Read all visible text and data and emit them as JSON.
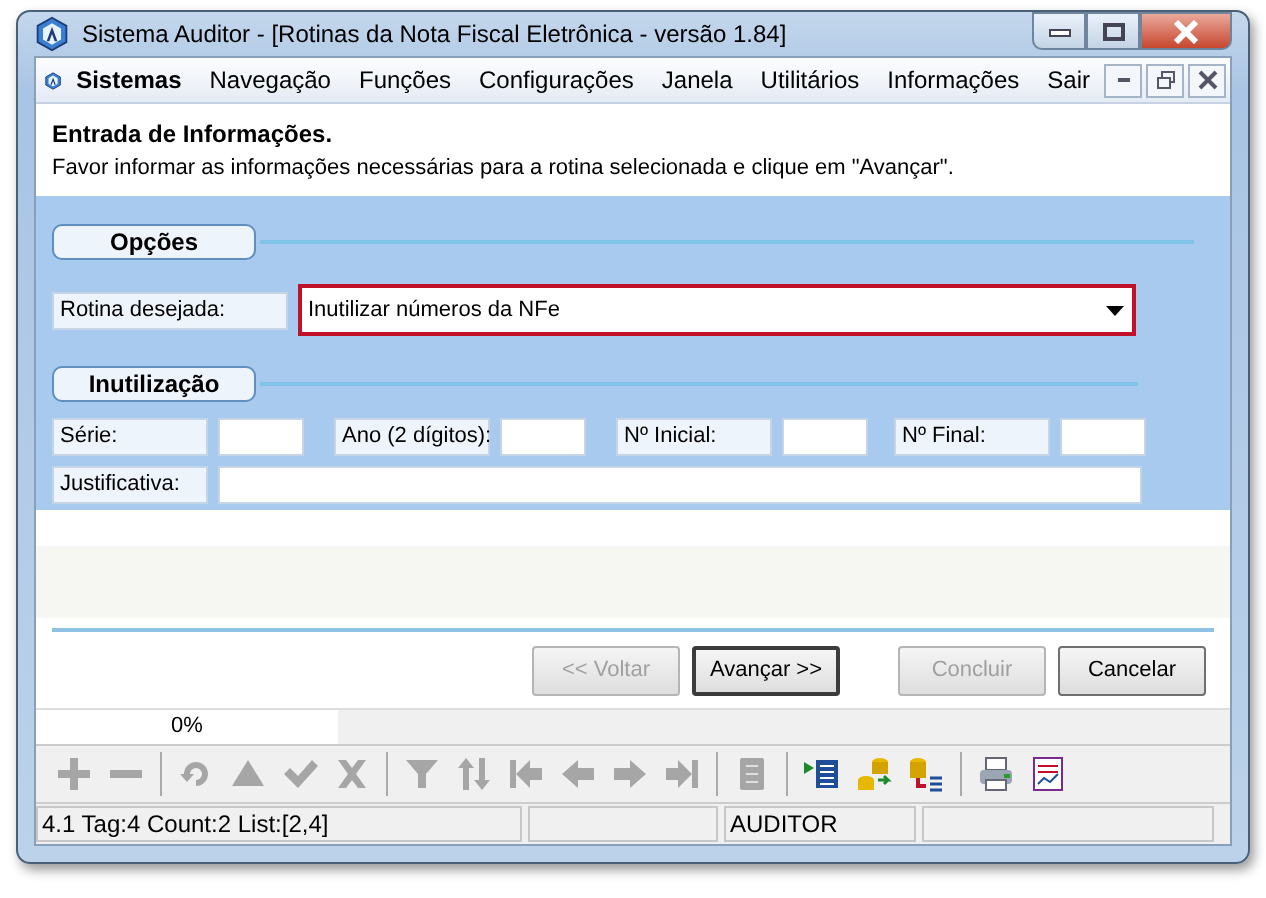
{
  "window": {
    "title": "Sistema Auditor - [Rotinas da Nota Fiscal Eletrônica - versão 1.84]"
  },
  "menu": {
    "items": [
      {
        "label": "Sistemas",
        "bold": true
      },
      {
        "label": "Navegação",
        "bold": false
      },
      {
        "label": "Funções",
        "bold": false
      },
      {
        "label": "Configurações",
        "bold": false
      },
      {
        "label": "Janela",
        "bold": false
      },
      {
        "label": "Utilitários",
        "bold": false
      },
      {
        "label": "Informações",
        "bold": false
      },
      {
        "label": "Sair",
        "bold": false
      }
    ]
  },
  "header": {
    "title": "Entrada de Informações.",
    "subtitle": "Favor informar as informações necessárias para a rotina selecionada e clique em \"Avançar\"."
  },
  "options": {
    "section": "Opções",
    "label": "Rotina desejada:",
    "value": "Inutilizar números da NFe"
  },
  "inutilizacao": {
    "section": "Inutilização",
    "fields": [
      {
        "label": "Série:"
      },
      {
        "label": "Ano (2 dígitos):"
      },
      {
        "label": "Nº Inicial:"
      },
      {
        "label": "Nº Final:"
      }
    ],
    "justificativa": "Justificativa:"
  },
  "button_groups": [
    [
      {
        "label": "<< Voltar",
        "disabled": true
      },
      {
        "label": "Avançar >>",
        "disabled": false
      }
    ],
    [
      {
        "label": "Concluir",
        "disabled": true
      },
      {
        "label": "Cancelar",
        "disabled": false
      }
    ]
  ],
  "progress": {
    "reading": "0%",
    "level": 0
  },
  "toolbar_groups": [
    [
      {
        "kind": "add",
        "disabled": true
      },
      {
        "kind": "remove",
        "disabled": true
      }
    ],
    [
      {
        "kind": "refresh",
        "disabled": true
      },
      {
        "kind": "up",
        "disabled": true
      },
      {
        "kind": "confirm",
        "disabled": true
      },
      {
        "kind": "cancel",
        "disabled": true
      }
    ],
    [
      {
        "kind": "filter",
        "disabled": true
      },
      {
        "kind": "sort",
        "disabled": true
      },
      {
        "kind": "first",
        "disabled": true
      },
      {
        "kind": "prev",
        "disabled": true
      },
      {
        "kind": "next",
        "disabled": true
      },
      {
        "kind": "last",
        "disabled": true
      }
    ],
    [
      {
        "kind": "doc",
        "disabled": true
      }
    ],
    [
      {
        "kind": "list",
        "disabled": false
      },
      {
        "kind": "swap",
        "disabled": false
      },
      {
        "kind": "dblist",
        "disabled": false
      }
    ],
    [
      {
        "kind": "print",
        "disabled": false
      },
      {
        "kind": "chart",
        "disabled": false
      }
    ]
  ],
  "status_bar": [
    "4.1 Tag:4 Count:2 List:[2,4]",
    "AUDITOR"
  ]
}
